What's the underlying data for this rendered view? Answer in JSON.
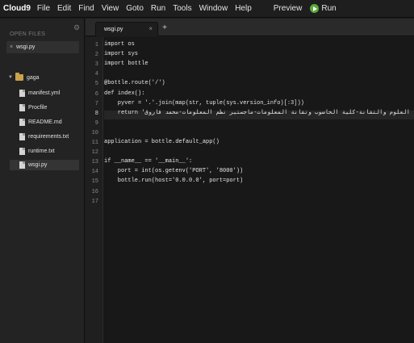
{
  "menubar": {
    "brand": "Cloud9",
    "items": [
      "File",
      "Edit",
      "Find",
      "View",
      "Goto",
      "Run",
      "Tools",
      "Window",
      "Help"
    ],
    "preview": "Preview",
    "run": "Run",
    "run_color": "#5aaa3a"
  },
  "sidebar": {
    "open_files_label": "OPEN FILES",
    "open_file": "wsgi.py",
    "root_folder": "gaga",
    "files": [
      "manifest.yml",
      "Procfile",
      "README.md",
      "requirements.txt",
      "runtime.txt",
      "wsgi.py"
    ],
    "selected_file": "wsgi.py"
  },
  "tabs": {
    "active": "wsgi.py",
    "close_glyph": "×",
    "plus_glyph": "+"
  },
  "editor": {
    "active_line": 8,
    "line_numbers": [
      "1",
      "2",
      "3",
      "4",
      "5",
      "6",
      "7",
      "8",
      "9",
      "10",
      "11",
      "12",
      "13",
      "14",
      "15",
      "16",
      "17"
    ],
    "lines": [
      "import os",
      "import sys",
      "import bottle",
      "",
      "@bottle.route('/')",
      "def index():",
      "    pyver = '.'.join(map(str, tuple(sys.version_info)[:3]))",
      "    return 'إجابة العلوم والتقانة-كلية الحاسوب وتقانة المعلومات-ماجستير نظم المعلومات-محمد فاروق (from <b>Pyth",
      "",
      "",
      "application = bottle.default_app()",
      "",
      "if __name__ == '__main__':",
      "    port = int(os.getenv('PORT', '8000'))",
      "    bottle.run(host='0.0.0.0', port=port)",
      "",
      ""
    ]
  }
}
